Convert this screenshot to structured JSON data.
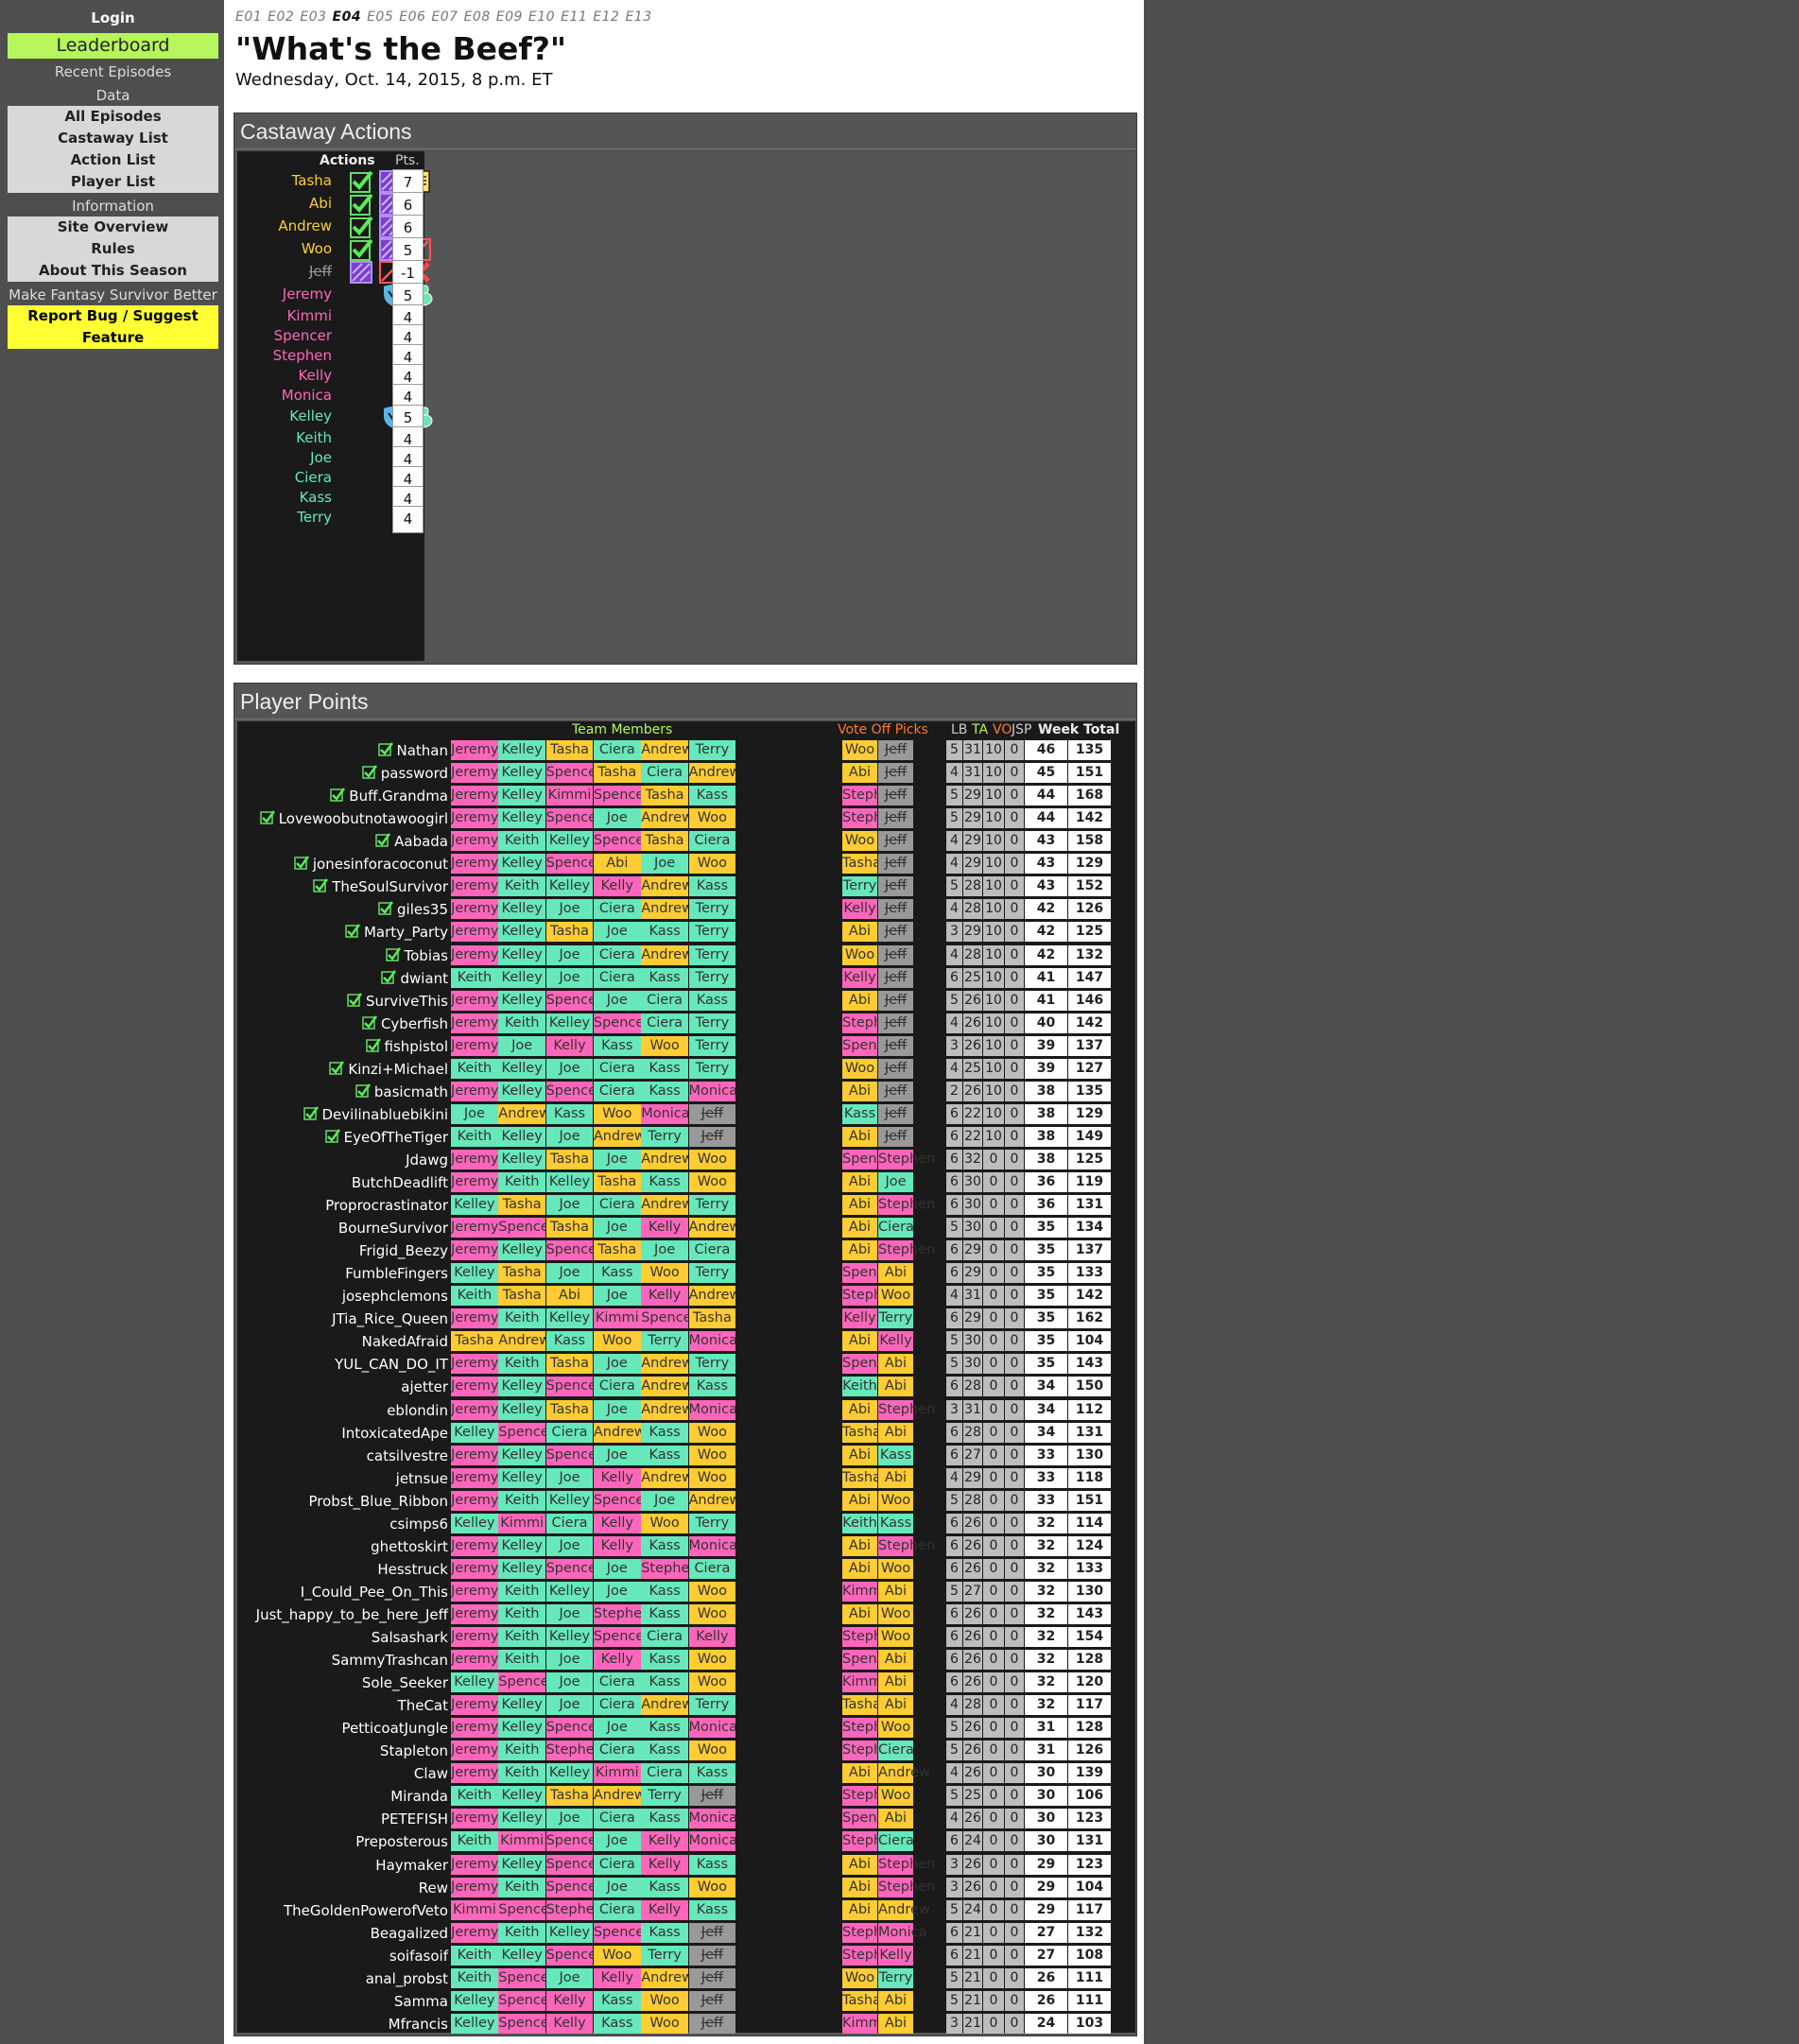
{
  "sidebar": {
    "login": "Login",
    "leaderboard": "Leaderboard",
    "recent": "Recent Episodes",
    "data_hdr": "Data",
    "all_eps": "All Episodes",
    "castaway_list": "Castaway List",
    "action_list": "Action List",
    "player_list": "Player List",
    "info_hdr": "Information",
    "site_overview": "Site Overview",
    "rules": "Rules",
    "about": "About This Season",
    "make_better": "Make Fantasy Survivor Better",
    "report_bug": "Report Bug / Suggest Feature"
  },
  "episodes": [
    "E01",
    "E02",
    "E03",
    "E04",
    "E05",
    "E06",
    "E07",
    "E08",
    "E09",
    "E10",
    "E11",
    "E12",
    "E13"
  ],
  "current_episode": "E04",
  "title": "\"What's the Beef?\"",
  "date": "Wednesday, Oct. 14, 2015, 8 p.m. ET",
  "colors": {
    "orange_team": "#ffcc33",
    "pink_team": "#ff66bb",
    "teal_team": "#66e8bb",
    "gray_team": "#999999"
  },
  "castaway_actions": {
    "title": "Castaway Actions",
    "col_actions": "Actions",
    "col_pts": "Pts.",
    "rows": [
      {
        "name": "Tasha",
        "tribe": "orange",
        "icons": [
          "check-icon",
          "immunity-icon",
          "document-icon"
        ],
        "pts": "7"
      },
      {
        "name": "Abi",
        "tribe": "orange",
        "icons": [
          "check-icon",
          "immunity-icon"
        ],
        "pts": "6"
      },
      {
        "name": "Andrew",
        "tribe": "orange",
        "icons": [
          "check-icon",
          "immunity-icon"
        ],
        "pts": "6"
      },
      {
        "name": "Woo",
        "tribe": "orange",
        "icons": [
          "check-icon",
          "immunity-icon",
          "no-vote-icon"
        ],
        "pts": "5"
      },
      {
        "name": "Jeff",
        "tribe": "gray",
        "strike": true,
        "icons": [
          "immunity-icon",
          "no-vote-icon",
          "voted-out-icon"
        ],
        "pts": "-1"
      },
      {
        "name": "Jeremy",
        "tribe": "pink",
        "icons": [
          "shield-icon",
          "reward-icon"
        ],
        "pts": "5"
      },
      {
        "name": "Kimmi",
        "tribe": "pink",
        "icons": [
          "shield-icon"
        ],
        "pts": "4"
      },
      {
        "name": "Spencer",
        "tribe": "pink",
        "icons": [
          "shield-icon"
        ],
        "pts": "4"
      },
      {
        "name": "Stephen",
        "tribe": "pink",
        "icons": [
          "shield-icon"
        ],
        "pts": "4"
      },
      {
        "name": "Kelly",
        "tribe": "pink",
        "icons": [
          "shield-icon"
        ],
        "pts": "4"
      },
      {
        "name": "Monica",
        "tribe": "pink",
        "icons": [
          "shield-icon"
        ],
        "pts": "4"
      },
      {
        "name": "Kelley",
        "tribe": "teal",
        "icons": [
          "shield-icon",
          "reward-icon"
        ],
        "pts": "5"
      },
      {
        "name": "Keith",
        "tribe": "teal",
        "icons": [
          "shield-icon"
        ],
        "pts": "4"
      },
      {
        "name": "Joe",
        "tribe": "teal",
        "icons": [
          "shield-icon"
        ],
        "pts": "4"
      },
      {
        "name": "Ciera",
        "tribe": "teal",
        "icons": [
          "shield-icon"
        ],
        "pts": "4"
      },
      {
        "name": "Kass",
        "tribe": "teal",
        "icons": [
          "shield-icon"
        ],
        "pts": "4"
      },
      {
        "name": "Terry",
        "tribe": "teal",
        "icons": [
          "shield-icon"
        ],
        "pts": "4"
      }
    ]
  },
  "player_points": {
    "title": "Player Points",
    "col_team": "Team Members",
    "col_vo": "Vote Off Picks",
    "col_lb": "LB",
    "col_ta": "TA",
    "col_vo2": "VO",
    "col_jsp": "JSP",
    "col_week": "Week",
    "col_total": "Total",
    "rows": [
      [
        "Nathan",
        1,
        "Jeremy Kelley Tasha Ciera Andrew Terry",
        "Woo Jeff",
        5,
        31,
        10,
        0,
        46,
        135
      ],
      [
        "password",
        1,
        "Jeremy Kelley Spencer Tasha Ciera Andrew",
        "Abi Jeff",
        4,
        31,
        10,
        0,
        45,
        151
      ],
      [
        "Buff.Grandma",
        1,
        "Jeremy Kelley Kimmi Spencer Tasha Kass",
        "Stephen Jeff",
        5,
        29,
        10,
        0,
        44,
        168
      ],
      [
        "Lovewoobutnotawoogirl",
        1,
        "Jeremy Kelley Spencer Joe Andrew Woo",
        "Stephen Jeff",
        5,
        29,
        10,
        0,
        44,
        142
      ],
      [
        "Aabada",
        1,
        "Jeremy Keith Kelley Spencer Tasha Ciera",
        "Woo Jeff",
        4,
        29,
        10,
        0,
        43,
        158
      ],
      [
        "jonesinforacoconut",
        1,
        "Jeremy Kelley Spencer Abi Joe Woo",
        "Tasha Jeff",
        4,
        29,
        10,
        0,
        43,
        129
      ],
      [
        "TheSoulSurvivor",
        1,
        "Jeremy Keith Kelley Kelly Andrew Kass",
        "Terry Jeff",
        5,
        28,
        10,
        0,
        43,
        152
      ],
      [
        "giles35",
        1,
        "Jeremy Kelley Joe Ciera Andrew Terry",
        "Kelly Jeff",
        4,
        28,
        10,
        0,
        42,
        126
      ],
      [
        "Marty_Party",
        1,
        "Jeremy Kelley Tasha Joe Kass Terry",
        "Abi Jeff",
        3,
        29,
        10,
        0,
        42,
        125
      ],
      [
        "Tobias",
        1,
        "Jeremy Kelley Joe Ciera Andrew Terry",
        "Woo Jeff",
        4,
        28,
        10,
        0,
        42,
        132
      ],
      [
        "dwiant",
        1,
        "Keith Kelley Joe Ciera Kass Terry",
        "Kelly Jeff",
        6,
        25,
        10,
        0,
        41,
        147
      ],
      [
        "SurviveThis",
        1,
        "Jeremy Kelley Spencer Joe Ciera Kass",
        "Abi Jeff",
        5,
        26,
        10,
        0,
        41,
        146
      ],
      [
        "Cyberfish",
        1,
        "Jeremy Keith Kelley Spencer Ciera Terry",
        "Stephen Jeff",
        4,
        26,
        10,
        0,
        40,
        142
      ],
      [
        "fishpistol",
        1,
        "Jeremy Joe Kelly Kass Woo Terry",
        "Spencer Jeff",
        3,
        26,
        10,
        0,
        39,
        137
      ],
      [
        "Kinzi+Michael",
        1,
        "Keith Kelley Joe Ciera Kass Terry",
        "Woo Jeff",
        4,
        25,
        10,
        0,
        39,
        127
      ],
      [
        "basicmath",
        1,
        "Jeremy Kelley Spencer Ciera Kass Monica",
        "Abi Jeff",
        2,
        26,
        10,
        0,
        38,
        135
      ],
      [
        "Devilinabluebikini",
        1,
        "Joe Andrew Kass Woo Monica Jeff",
        "Kass Jeff",
        6,
        22,
        10,
        0,
        38,
        129
      ],
      [
        "EyeOfTheTiger",
        1,
        "Keith Kelley Joe Andrew Terry Jeff",
        "Abi Jeff",
        6,
        22,
        10,
        0,
        38,
        149
      ],
      [
        "Jdawg",
        0,
        "Jeremy Kelley Tasha Joe Andrew Woo",
        "Spencer Stephen",
        6,
        32,
        0,
        0,
        38,
        125
      ],
      [
        "ButchDeadlift",
        0,
        "Jeremy Keith Kelley Tasha Kass Woo",
        "Abi Joe",
        6,
        30,
        0,
        0,
        36,
        119
      ],
      [
        "Proprocrastinator",
        0,
        "Kelley Tasha Joe Ciera Andrew Terry",
        "Abi Stephen",
        6,
        30,
        0,
        0,
        36,
        131
      ],
      [
        "BourneSurvivor",
        0,
        "Jeremy Spencer Tasha Joe Kelly Andrew",
        "Abi Ciera",
        5,
        30,
        0,
        0,
        35,
        134
      ],
      [
        "Frigid_Beezy",
        0,
        "Jeremy Kelley Spencer Tasha Joe Ciera",
        "Abi Stephen",
        6,
        29,
        0,
        0,
        35,
        137
      ],
      [
        "FumbleFingers",
        0,
        "Kelley Tasha Joe Kass Woo Terry",
        "Spencer Abi",
        6,
        29,
        0,
        0,
        35,
        133
      ],
      [
        "josephclemons",
        0,
        "Keith Tasha Abi Joe Kelly Andrew",
        "Stephen Woo",
        4,
        31,
        0,
        0,
        35,
        142
      ],
      [
        "JTia_Rice_Queen",
        0,
        "Jeremy Keith Kelley Kimmi Spencer Tasha",
        "Kelly Terry",
        6,
        29,
        0,
        0,
        35,
        162
      ],
      [
        "NakedAfraid",
        0,
        "Tasha Andrew Kass Woo Terry Monica",
        "Abi Kelly",
        5,
        30,
        0,
        0,
        35,
        104
      ],
      [
        "YUL_CAN_DO_IT",
        0,
        "Jeremy Keith Tasha Joe Andrew Terry",
        "Spencer Abi",
        5,
        30,
        0,
        0,
        35,
        143
      ],
      [
        "ajetter",
        0,
        "Jeremy Kelley Spencer Ciera Andrew Kass",
        "Keith Abi",
        6,
        28,
        0,
        0,
        34,
        150
      ],
      [
        "eblondin",
        0,
        "Jeremy Kelley Tasha Joe Andrew Monica",
        "Abi Stephen",
        3,
        31,
        0,
        0,
        34,
        112
      ],
      [
        "IntoxicatedApe",
        0,
        "Kelley Spencer Ciera Andrew Kass Woo",
        "Tasha Abi",
        6,
        28,
        0,
        0,
        34,
        131
      ],
      [
        "catsilvestre",
        0,
        "Jeremy Kelley Spencer Joe Kass Woo",
        "Abi Kass",
        6,
        27,
        0,
        0,
        33,
        130
      ],
      [
        "jetnsue",
        0,
        "Jeremy Kelley Joe Kelly Andrew Woo",
        "Tasha Abi",
        4,
        29,
        0,
        0,
        33,
        118
      ],
      [
        "Probst_Blue_Ribbon",
        0,
        "Jeremy Keith Kelley Spencer Joe Andrew",
        "Abi Woo",
        5,
        28,
        0,
        0,
        33,
        151
      ],
      [
        "csimps6",
        0,
        "Kelley Kimmi Ciera Kelly Woo Terry",
        "Keith Kass",
        6,
        26,
        0,
        0,
        32,
        114
      ],
      [
        "ghettoskirt",
        0,
        "Jeremy Kelley Joe Kelly Kass Monica",
        "Abi Stephen",
        6,
        26,
        0,
        0,
        32,
        124
      ],
      [
        "Hesstruck",
        0,
        "Jeremy Kelley Spencer Joe Stephen Ciera",
        "Abi Woo",
        6,
        26,
        0,
        0,
        32,
        133
      ],
      [
        "I_Could_Pee_On_This",
        0,
        "Jeremy Keith Kelley Joe Kass Woo",
        "Kimmi Abi",
        5,
        27,
        0,
        0,
        32,
        130
      ],
      [
        "Just_happy_to_be_here_Jeff",
        0,
        "Jeremy Keith Joe Stephen Kass Woo",
        "Abi Woo",
        6,
        26,
        0,
        0,
        32,
        143
      ],
      [
        "Salsashark",
        0,
        "Jeremy Keith Kelley Spencer Ciera Kelly",
        "Stephen Woo",
        6,
        26,
        0,
        0,
        32,
        154
      ],
      [
        "SammyTrashcan",
        0,
        "Jeremy Keith Joe Kelly Kass Woo",
        "Spencer Abi",
        6,
        26,
        0,
        0,
        32,
        128
      ],
      [
        "Sole_Seeker",
        0,
        "Kelley Spencer Joe Ciera Kass Woo",
        "Kimmi Abi",
        6,
        26,
        0,
        0,
        32,
        120
      ],
      [
        "TheCat",
        0,
        "Jeremy Kelley Joe Ciera Andrew Terry",
        "Tasha Abi",
        4,
        28,
        0,
        0,
        32,
        117
      ],
      [
        "PetticoatJungle",
        0,
        "Jeremy Kelley Spencer Joe Kass Monica",
        "Stephen Woo",
        5,
        26,
        0,
        0,
        31,
        128
      ],
      [
        "Stapleton",
        0,
        "Jeremy Keith Stephen Ciera Kass Woo",
        "Stephen Ciera",
        5,
        26,
        0,
        0,
        31,
        126
      ],
      [
        "Claw",
        0,
        "Jeremy Keith Kelley Kimmi Ciera Kass",
        "Abi Andrew",
        4,
        26,
        0,
        0,
        30,
        139
      ],
      [
        "Miranda",
        0,
        "Keith Kelley Tasha Andrew Terry Jeff",
        "Stephen Woo",
        5,
        25,
        0,
        0,
        30,
        106
      ],
      [
        "PETEFISH",
        0,
        "Jeremy Kelley Joe Ciera Kass Monica",
        "Spencer Abi",
        4,
        26,
        0,
        0,
        30,
        123
      ],
      [
        "Preposterous",
        0,
        "Keith Kimmi Spencer Joe Kelly Monica",
        "Stephen Ciera",
        6,
        24,
        0,
        0,
        30,
        131
      ],
      [
        "Haymaker",
        0,
        "Jeremy Kelley Spencer Ciera Kelly Kass",
        "Abi Stephen",
        3,
        26,
        0,
        0,
        29,
        123
      ],
      [
        "Rew",
        0,
        "Jeremy Keith Spencer Joe Kass Woo",
        "Abi Stephen",
        3,
        26,
        0,
        0,
        29,
        104
      ],
      [
        "TheGoldenPowerofVeto",
        0,
        "Kimmi Spencer Stephen Ciera Kelly Kass",
        "Abi Andrew",
        5,
        24,
        0,
        0,
        29,
        117
      ],
      [
        "Beagalized",
        0,
        "Jeremy Keith Kelley Spencer Kass Jeff",
        "Stephen Monica",
        6,
        21,
        0,
        0,
        27,
        132
      ],
      [
        "soifasoif",
        0,
        "Keith Kelley Spencer Woo Terry Jeff",
        "Stephen Kelly",
        6,
        21,
        0,
        0,
        27,
        108
      ],
      [
        "anal_probst",
        0,
        "Keith Spencer Joe Kelly Andrew Jeff",
        "Woo Terry",
        5,
        21,
        0,
        0,
        26,
        111
      ],
      [
        "Samma",
        0,
        "Kelley Spencer Kelly Kass Woo Jeff",
        "Tasha Abi",
        5,
        21,
        0,
        0,
        26,
        111
      ],
      [
        "Mfrancis",
        0,
        "Kelley Spencer Kelly Kass Woo Jeff",
        "Kimmi Abi",
        3,
        21,
        0,
        0,
        24,
        103
      ]
    ]
  }
}
